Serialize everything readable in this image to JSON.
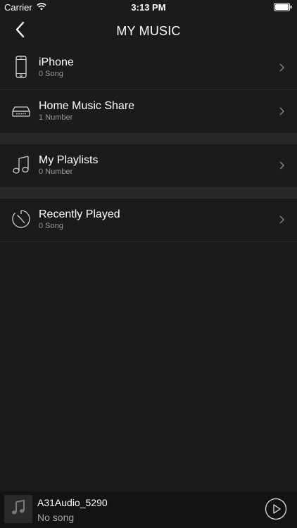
{
  "status_bar": {
    "carrier": "Carrier",
    "time": "3:13 PM"
  },
  "nav": {
    "title": "MY MUSIC"
  },
  "sections": [
    {
      "items": [
        {
          "title": "iPhone",
          "subtitle": "0 Song",
          "icon": "phone-icon"
        },
        {
          "title": "Home Music Share",
          "subtitle": "1 Number",
          "icon": "router-icon"
        }
      ]
    },
    {
      "items": [
        {
          "title": "My Playlists",
          "subtitle": "0 Number",
          "icon": "music-note-icon"
        }
      ]
    },
    {
      "items": [
        {
          "title": "Recently Played",
          "subtitle": "0 Song",
          "icon": "clock-icon"
        }
      ]
    }
  ],
  "player": {
    "device": "A31Audio_5290",
    "track": "No song"
  },
  "colors": {
    "background": "#1b1b1b",
    "section_gap": "#262626",
    "divider": "#2c2c2c",
    "subtitle": "#9a9a9a",
    "player_bg": "#131313"
  }
}
